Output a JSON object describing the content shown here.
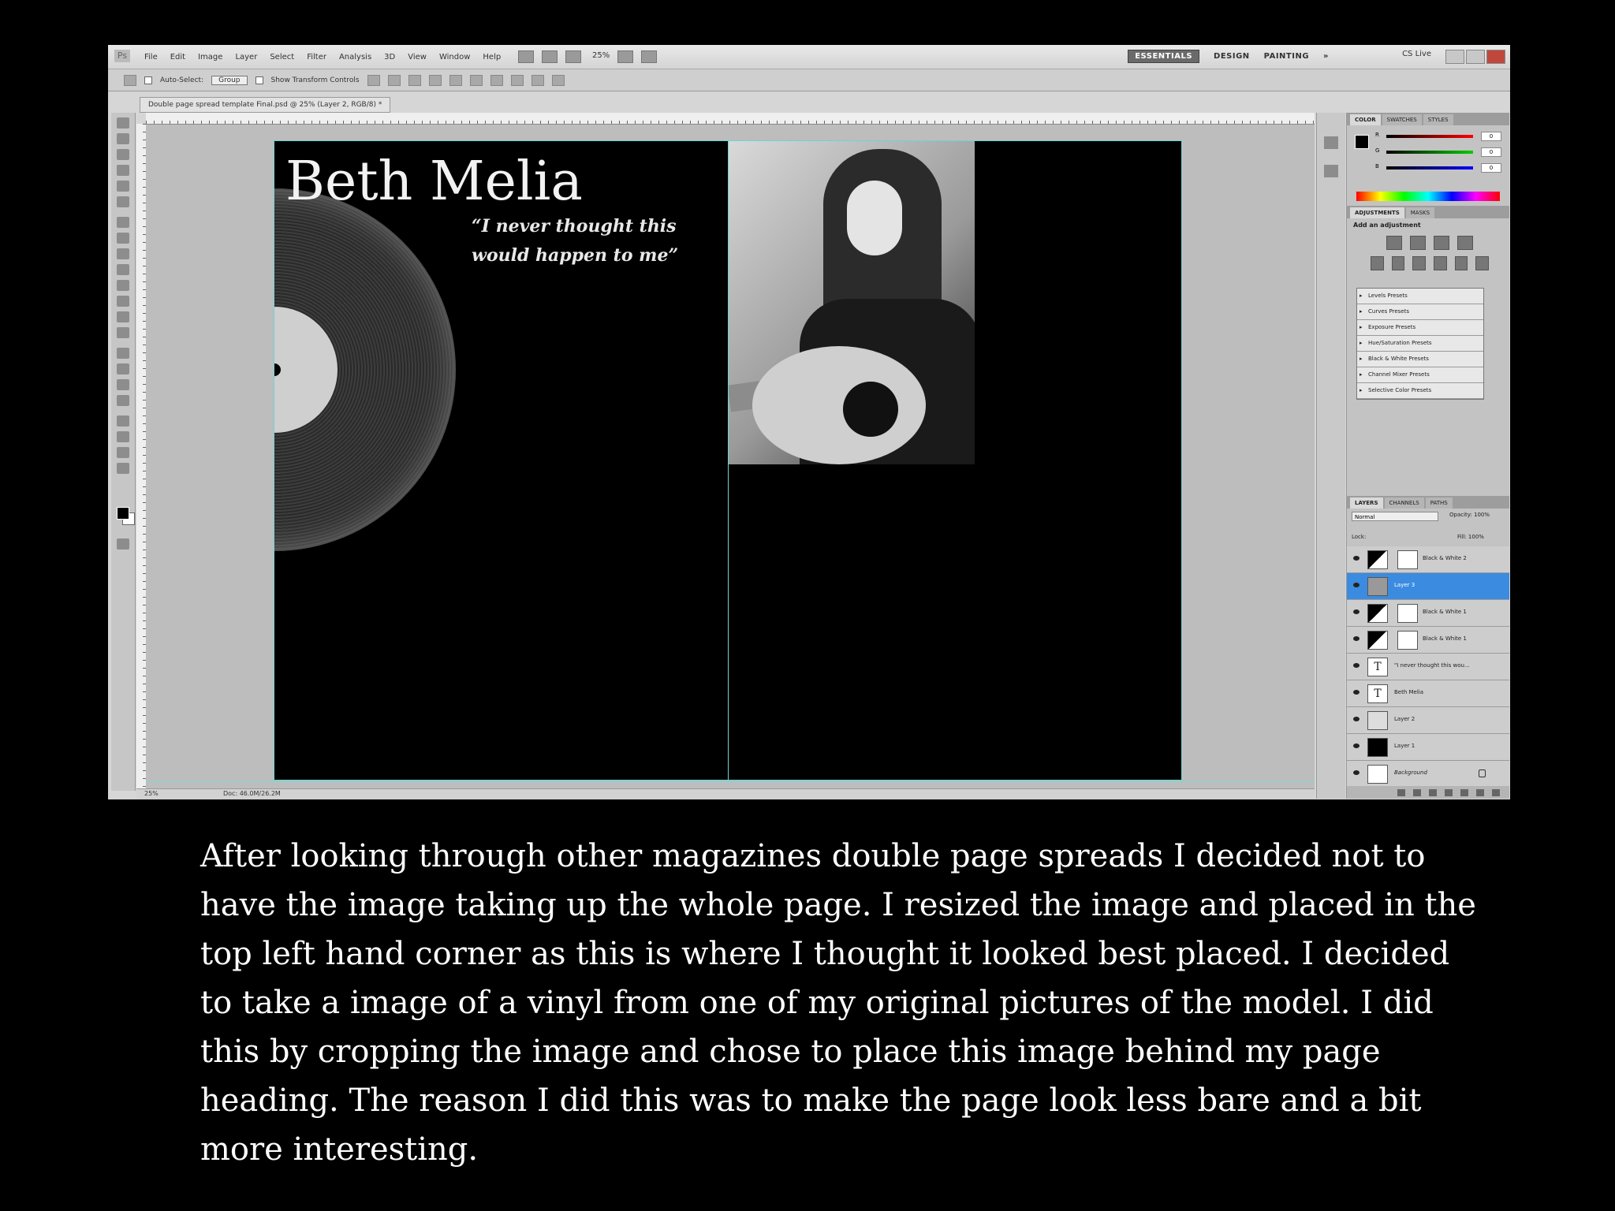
{
  "menubar": {
    "logo": "Ps",
    "menus": [
      "File",
      "Edit",
      "Image",
      "Layer",
      "Select",
      "Filter",
      "Analysis",
      "3D",
      "View",
      "Window",
      "Help"
    ],
    "zoom": "25%",
    "workspaces": [
      "ESSENTIALS",
      "DESIGN",
      "PAINTING"
    ],
    "more": "»",
    "cslive": "CS Live"
  },
  "optionsbar": {
    "auto_select": "Auto-Select:",
    "group": "Group",
    "show_transform": "Show Transform Controls"
  },
  "document": {
    "tab": "Double page spread template Final.psd @ 25% (Layer 2, RGB/8) *",
    "status_zoom": "25%",
    "status_doc": "Doc: 46.0M/26.2M"
  },
  "artwork": {
    "title": "Beth Melia",
    "quote": "“I never thought this would happen to me”"
  },
  "panels": {
    "color_tabs": [
      "COLOR",
      "SWATCHES",
      "STYLES"
    ],
    "rgb_labels": [
      "R",
      "G",
      "B"
    ],
    "rgb_values": [
      "0",
      "0",
      "0"
    ],
    "adjust_tabs": [
      "ADJUSTMENTS",
      "MASKS"
    ],
    "adjust_title": "Add an adjustment",
    "presets": [
      "Levels Presets",
      "Curves Presets",
      "Exposure Presets",
      "Hue/Saturation Presets",
      "Black & White Presets",
      "Channel Mixer Presets",
      "Selective Color Presets"
    ],
    "layers_tabs": [
      "LAYERS",
      "CHANNELS",
      "PATHS"
    ],
    "blend_mode": "Normal",
    "opacity": "Opacity: 100%",
    "lock": "Lock:",
    "fill": "Fill: 100%",
    "layers": [
      {
        "name": "Black & White 2",
        "kind": "adj"
      },
      {
        "name": "Layer 3",
        "kind": "photo",
        "selected": true
      },
      {
        "name": "Black & White 1",
        "kind": "adj"
      },
      {
        "name": "Black & White 1",
        "kind": "adj"
      },
      {
        "name": "\"I never thought this wou...",
        "kind": "text"
      },
      {
        "name": "Beth Melia",
        "kind": "text"
      },
      {
        "name": "Layer 2",
        "kind": "photo"
      },
      {
        "name": "Layer 1",
        "kind": "fill"
      },
      {
        "name": "Background",
        "kind": "bg"
      }
    ]
  },
  "caption": "After looking through other magazines double page spreads I decided not to have the image taking up the whole page. I resized the image and placed in the top left hand corner as this is where I thought it looked best placed. I decided to take a image of a vinyl from one of my original pictures of the model. I did this by cropping the image and chose to place this image behind my page heading. The reason I did this was to make the page look less bare and a bit more interesting."
}
